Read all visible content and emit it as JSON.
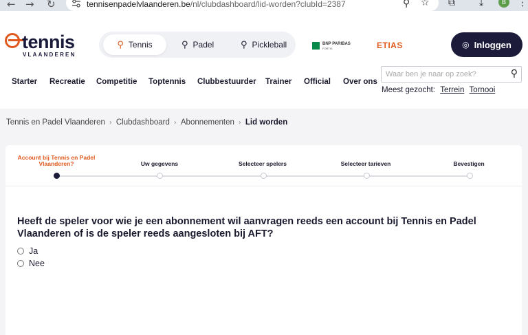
{
  "browser": {
    "url_domain": "tennisenpadelvlaanderen.be",
    "url_path": "/nl/clubdashboard/lid-worden?clubId=2387",
    "profile_initial": "B"
  },
  "header": {
    "logo_word": "tennis",
    "logo_sub": "VLAANDEREN",
    "sports": [
      {
        "label": "Tennis",
        "icon": "tennis-racket-icon"
      },
      {
        "label": "Padel",
        "icon": "padel-icon"
      },
      {
        "label": "Pickleball",
        "icon": "pickleball-icon"
      }
    ],
    "sponsor1_line1": "BNP PARIBAS",
    "sponsor1_line2": "FORTIS",
    "sponsor2": "ETIAS",
    "login_label": "Inloggen",
    "nav": [
      "Starter",
      "Recreatie",
      "Competitie",
      "Toptennis",
      "Clubbestuurder",
      "Trainer",
      "Official",
      "Over ons"
    ],
    "search_placeholder": "Waar ben je naar op zoek?",
    "popular_label": "Meest gezocht:",
    "popular_links": [
      "Terrein",
      "Tornooi"
    ]
  },
  "breadcrumb": [
    "Tennis en Padel Vlaanderen",
    "Clubdashboard",
    "Abonnementen",
    "Lid worden"
  ],
  "stepper": {
    "steps": [
      "Account bij Tennis en Padel Vlaanderen?",
      "Uw gegevens",
      "Selecteer spelers",
      "Selecteer tarieven",
      "Bevestigen"
    ],
    "active_index": 0,
    "accent": "#e05a1f"
  },
  "question": {
    "text": "Heeft de speler voor wie je een abonnement wil aanvragen reeds een account bij Tennis en Padel Vlaanderen of is de speler reeds aangesloten bij AFT?",
    "options": [
      "Ja",
      "Nee"
    ]
  },
  "colors": {
    "brand_navy": "#1c1b3a",
    "brand_orange": "#e05a1f"
  }
}
